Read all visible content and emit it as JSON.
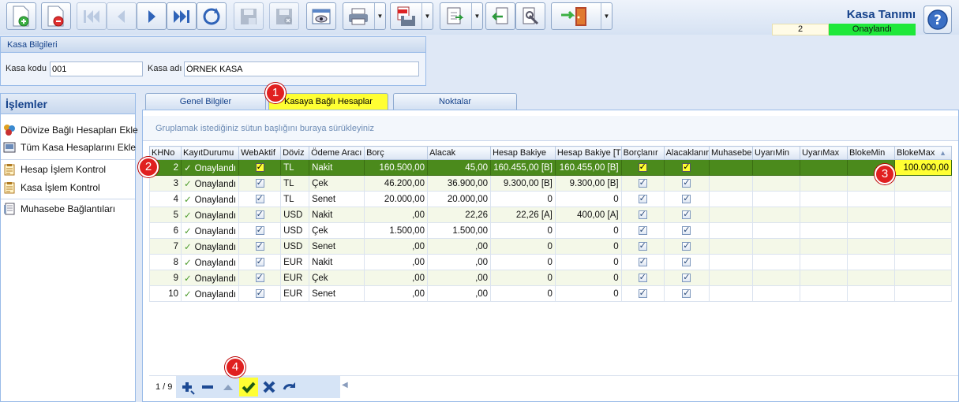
{
  "toolbar": {
    "buttons": [
      {
        "name": "new-icon"
      },
      {
        "name": "delete-icon"
      },
      {
        "name": "first-record-icon"
      },
      {
        "name": "previous-record-icon"
      },
      {
        "name": "next-record-icon"
      },
      {
        "name": "last-record-icon"
      },
      {
        "name": "refresh-icon"
      },
      {
        "name": "save-icon"
      },
      {
        "name": "cancel-save-icon"
      },
      {
        "name": "preview-icon"
      },
      {
        "name": "print-icon"
      },
      {
        "name": "pdf-export-icon"
      },
      {
        "name": "excel-export-icon"
      },
      {
        "name": "import-icon"
      },
      {
        "name": "tools-icon"
      },
      {
        "name": "exit-icon"
      }
    ]
  },
  "header": {
    "title": "Kasa Tanımı",
    "record_count": "2",
    "status": "Onaylandı",
    "status_color": "#1fe83a"
  },
  "kasa_bilgileri": {
    "title": "Kasa Bilgileri",
    "kasa_kodu_label": "Kasa kodu",
    "kasa_kodu_value": "001",
    "kasa_adi_label": "Kasa adı",
    "kasa_adi_value": "ÖRNEK KASA"
  },
  "islemler": {
    "title": "İşlemler",
    "items": [
      {
        "label": "Dövize Bağlı Hesapları Ekle",
        "icon": "currency-icon"
      },
      {
        "label": "Tüm Kasa Hesaplarını Ekle",
        "icon": "cash-register-icon"
      },
      {
        "label": "Hesap İşlem Kontrol",
        "icon": "clipboard-icon"
      },
      {
        "label": "Kasa İşlem Kontrol",
        "icon": "clipboard-icon"
      },
      {
        "label": "Muhasebe Bağlantıları",
        "icon": "ledger-icon"
      }
    ]
  },
  "tabs": [
    {
      "label": "Genel Bilgiler",
      "active": false
    },
    {
      "label": "Kasaya Bağlı Hesaplar",
      "active": true
    },
    {
      "label": "Noktalar",
      "active": false
    }
  ],
  "grid": {
    "group_hint": "Gruplamak istediğiniz sütun başlığını buraya sürükleyiniz",
    "columns": [
      "KHNo",
      "KayıtDurumu",
      "WebAktif",
      "Döviz",
      "Ödeme Aracı",
      "Borç",
      "Alacak",
      "Hesap Bakiye",
      "Hesap Bakiye [T",
      "Borçlanır",
      "Alacaklanır",
      "Muhasebe",
      "UyarıMin",
      "UyarıMax",
      "BlokeMin",
      "BlokeMax"
    ],
    "rows": [
      {
        "khno": "2",
        "durum": "Onaylandı",
        "web": true,
        "doviz": "TL",
        "odeme": "Nakit",
        "borc": "160.500,00",
        "alacak": "45,00",
        "bakiye": "160.455,00 [B]",
        "bakiye_t": "160.455,00 [B]",
        "borclanir": true,
        "alacaklanir": true,
        "muhasebe": "",
        "uyarimin": "",
        "uyarimax": "",
        "blokemin": "",
        "blokemax": "100.000,00"
      },
      {
        "khno": "3",
        "durum": "Onaylandı",
        "web": true,
        "doviz": "TL",
        "odeme": "Çek",
        "borc": "46.200,00",
        "alacak": "36.900,00",
        "bakiye": "9.300,00 [B]",
        "bakiye_t": "9.300,00 [B]",
        "borclanir": true,
        "alacaklanir": true,
        "muhasebe": "",
        "uyarimin": "",
        "uyarimax": "",
        "blokemin": "",
        "blokemax": ""
      },
      {
        "khno": "4",
        "durum": "Onaylandı",
        "web": true,
        "doviz": "TL",
        "odeme": "Senet",
        "borc": "20.000,00",
        "alacak": "20.000,00",
        "bakiye": "0",
        "bakiye_t": "0",
        "borclanir": true,
        "alacaklanir": true,
        "muhasebe": "",
        "uyarimin": "",
        "uyarimax": "",
        "blokemin": "",
        "blokemax": ""
      },
      {
        "khno": "5",
        "durum": "Onaylandı",
        "web": true,
        "doviz": "USD",
        "odeme": "Nakit",
        "borc": ",00",
        "alacak": "22,26",
        "bakiye": "22,26 [A]",
        "bakiye_t": "400,00 [A]",
        "borclanir": true,
        "alacaklanir": true,
        "muhasebe": "",
        "uyarimin": "",
        "uyarimax": "",
        "blokemin": "",
        "blokemax": ""
      },
      {
        "khno": "6",
        "durum": "Onaylandı",
        "web": true,
        "doviz": "USD",
        "odeme": "Çek",
        "borc": "1.500,00",
        "alacak": "1.500,00",
        "bakiye": "0",
        "bakiye_t": "0",
        "borclanir": true,
        "alacaklanir": true,
        "muhasebe": "",
        "uyarimin": "",
        "uyarimax": "",
        "blokemin": "",
        "blokemax": ""
      },
      {
        "khno": "7",
        "durum": "Onaylandı",
        "web": true,
        "doviz": "USD",
        "odeme": "Senet",
        "borc": ",00",
        "alacak": ",00",
        "bakiye": "0",
        "bakiye_t": "0",
        "borclanir": true,
        "alacaklanir": true,
        "muhasebe": "",
        "uyarimin": "",
        "uyarimax": "",
        "blokemin": "",
        "blokemax": ""
      },
      {
        "khno": "8",
        "durum": "Onaylandı",
        "web": true,
        "doviz": "EUR",
        "odeme": "Nakit",
        "borc": ",00",
        "alacak": ",00",
        "bakiye": "0",
        "bakiye_t": "0",
        "borclanir": true,
        "alacaklanir": true,
        "muhasebe": "",
        "uyarimin": "",
        "uyarimax": "",
        "blokemin": "",
        "blokemax": ""
      },
      {
        "khno": "9",
        "durum": "Onaylandı",
        "web": true,
        "doviz": "EUR",
        "odeme": "Çek",
        "borc": ",00",
        "alacak": ",00",
        "bakiye": "0",
        "bakiye_t": "0",
        "borclanir": true,
        "alacaklanir": true,
        "muhasebe": "",
        "uyarimin": "",
        "uyarimax": "",
        "blokemin": "",
        "blokemax": ""
      },
      {
        "khno": "10",
        "durum": "Onaylandı",
        "web": true,
        "doviz": "EUR",
        "odeme": "Senet",
        "borc": ",00",
        "alacak": ",00",
        "bakiye": "0",
        "bakiye_t": "0",
        "borclanir": true,
        "alacaklanir": true,
        "muhasebe": "",
        "uyarimin": "",
        "uyarimax": "",
        "blokemin": "",
        "blokemax": ""
      }
    ],
    "selected_row_index": 0
  },
  "navigator": {
    "position": "1 / 9",
    "buttons": [
      "add-icon",
      "remove-icon",
      "up-icon",
      "confirm-icon",
      "cancel-icon",
      "undo-icon"
    ]
  },
  "callouts": [
    "1",
    "2",
    "3",
    "4"
  ]
}
